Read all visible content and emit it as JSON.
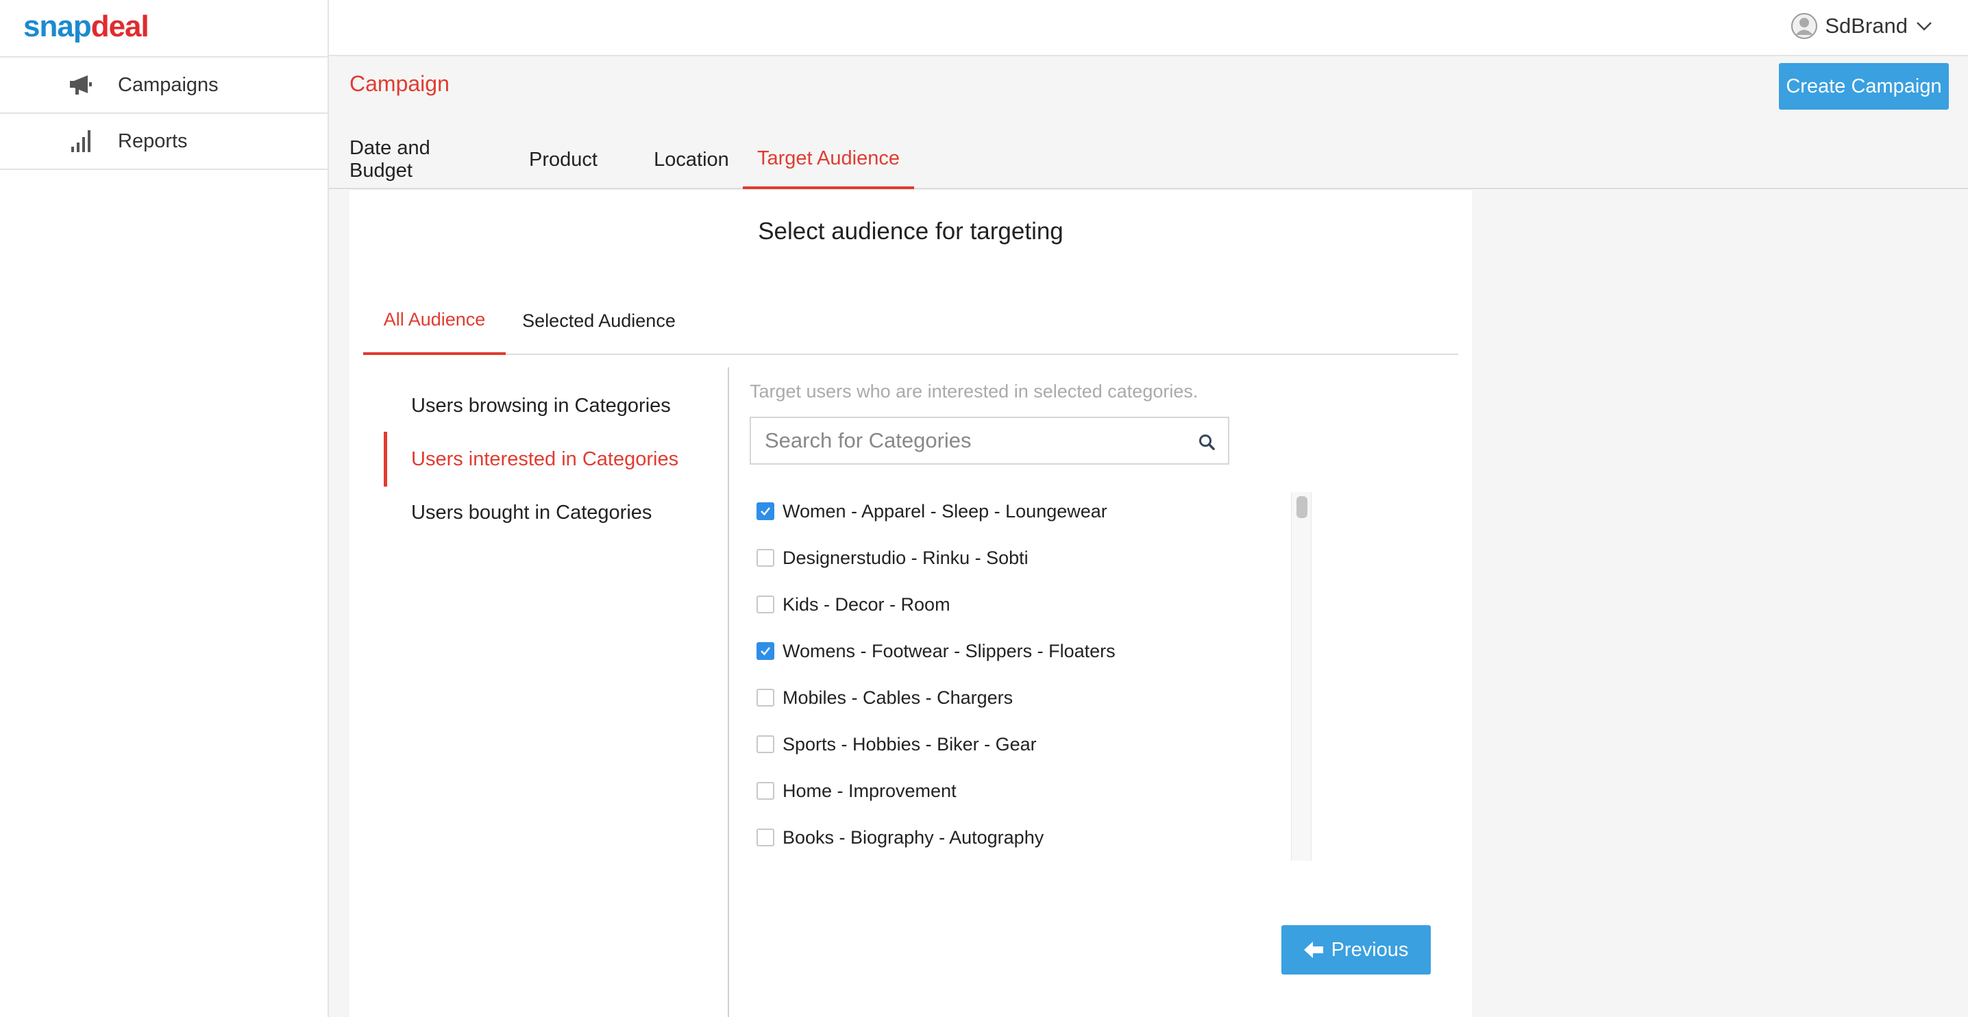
{
  "brand": {
    "logo_part1": "snap",
    "logo_part2": "deal"
  },
  "sidebar": {
    "items": [
      {
        "label": "Campaigns",
        "icon": "megaphone-icon"
      },
      {
        "label": "Reports",
        "icon": "bar-chart-icon"
      }
    ]
  },
  "topbar": {
    "user_name": "SdBrand"
  },
  "header": {
    "title": "Campaign",
    "create_button": "Create Campaign"
  },
  "tabs": [
    {
      "label": "Date and Budget",
      "active": false
    },
    {
      "label": "Product",
      "active": false
    },
    {
      "label": "Location",
      "active": false
    },
    {
      "label": "Target Audience",
      "active": true
    }
  ],
  "card": {
    "title": "Select audience for targeting",
    "subtabs": [
      {
        "label": "All Audience",
        "active": true
      },
      {
        "label": "Selected Audience",
        "active": false
      }
    ],
    "left_menu": [
      {
        "label": "Users browsing in Categories",
        "active": false
      },
      {
        "label": "Users interested in Categories",
        "active": true
      },
      {
        "label": "Users bought in Categories",
        "active": false
      }
    ],
    "hint": "Target users who are interested in selected categories.",
    "search_placeholder": "Search for Categories",
    "categories": [
      {
        "label": "Women - Apparel - Sleep - Loungewear",
        "checked": true
      },
      {
        "label": "Designerstudio - Rinku - Sobti",
        "checked": false
      },
      {
        "label": "Kids - Decor - Room",
        "checked": false
      },
      {
        "label": "Womens - Footwear - Slippers - Floaters",
        "checked": true
      },
      {
        "label": "Mobiles - Cables - Chargers",
        "checked": false
      },
      {
        "label": "Sports - Hobbies - Biker - Gear",
        "checked": false
      },
      {
        "label": "Home - Improvement",
        "checked": false
      },
      {
        "label": "Books - Biography - Autography",
        "checked": false
      }
    ],
    "previous_button": "Previous"
  },
  "colors": {
    "accent_red": "#e03c31",
    "primary_blue": "#3aa0e0",
    "checkbox_blue": "#2e8ee8"
  }
}
